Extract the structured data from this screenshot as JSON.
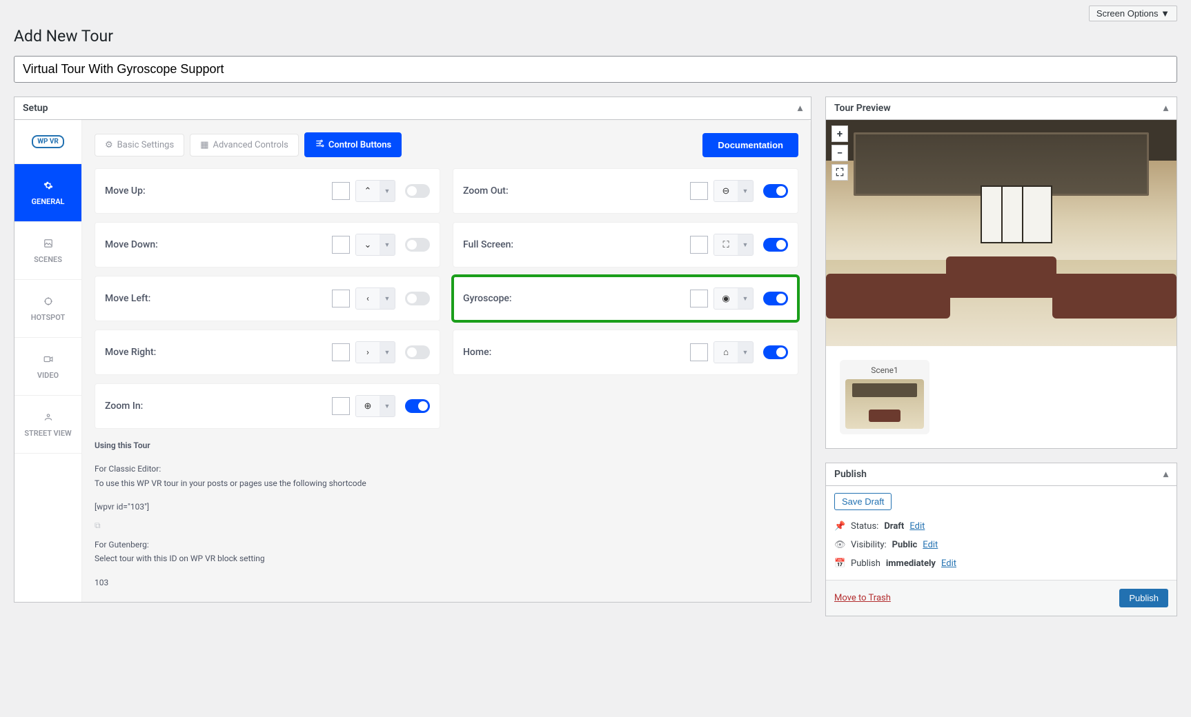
{
  "screen_options": "Screen Options ▼",
  "page_title": "Add New Tour",
  "tour_title": "Virtual Tour With Gyroscope Support",
  "setup_box_title": "Setup",
  "side_tabs": {
    "logo": "WP VR",
    "general": "GENERAL",
    "scenes": "SCENES",
    "hotspot": "HOTSPOT",
    "video": "VIDEO",
    "street": "STREET VIEW"
  },
  "sub_tabs": {
    "basic": "Basic Settings",
    "advanced": "Advanced Controls",
    "control": "Control Buttons"
  },
  "doc_btn": "Documentation",
  "controls": {
    "move_up": "Move Up:",
    "move_down": "Move Down:",
    "move_left": "Move Left:",
    "move_right": "Move Right:",
    "zoom_in": "Zoom In:",
    "zoom_out": "Zoom Out:",
    "full_screen": "Full Screen:",
    "gyroscope": "Gyroscope:",
    "home": "Home:"
  },
  "usage": {
    "title": "Using this Tour",
    "classic_label": "For Classic Editor:",
    "classic_text": "To use this WP VR tour in your posts or pages use the following shortcode",
    "shortcode": "[wpvr id=\"103\"]",
    "gutenberg_label": "For Gutenberg:",
    "gutenberg_text": "Select tour with this ID on WP VR block setting",
    "id": "103"
  },
  "preview": {
    "title": "Tour Preview",
    "scene_label": "Scene1"
  },
  "publish": {
    "title": "Publish",
    "save_draft": "Save Draft",
    "status_label": "Status:",
    "status_value": "Draft",
    "visibility_label": "Visibility:",
    "visibility_value": "Public",
    "schedule_label": "Publish",
    "schedule_value": "immediately",
    "edit": "Edit",
    "trash": "Move to Trash",
    "publish_btn": "Publish"
  }
}
